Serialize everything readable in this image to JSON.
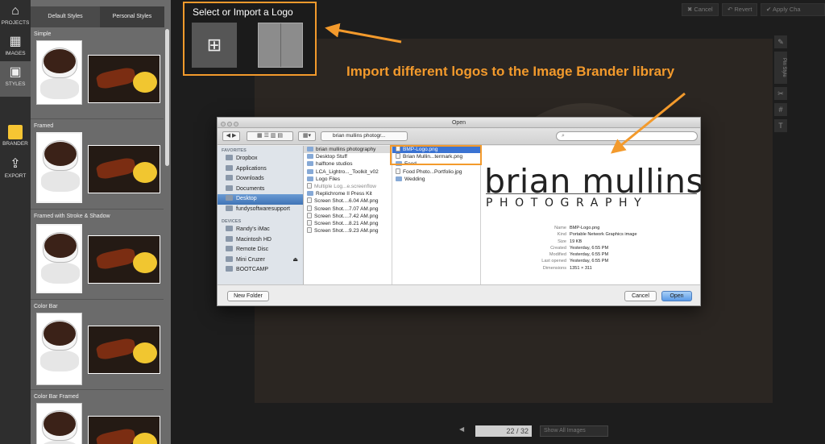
{
  "rail": [
    {
      "label": "PROJECTS",
      "icon": "home-icon",
      "glyph": "⌂"
    },
    {
      "label": "IMAGES",
      "icon": "images-icon",
      "glyph": "▦"
    },
    {
      "label": "STYLES",
      "icon": "styles-icon",
      "glyph": "▣"
    },
    {
      "label": "BRANDER",
      "icon": "brander-icon",
      "glyph": ""
    },
    {
      "label": "EXPORT",
      "icon": "export-icon",
      "glyph": "⇪"
    }
  ],
  "panel": {
    "tabs": [
      "Default Styles",
      "Personal Styles"
    ],
    "groups": [
      "Simple",
      "Framed",
      "Framed with Stroke & Shadow",
      "Color Bar",
      "Color Bar Framed"
    ]
  },
  "top_actions": {
    "cancel": "Cancel",
    "revert": "Revert",
    "apply": "Apply Cha"
  },
  "side_tools": {
    "pin_style": "Pin Style"
  },
  "logo_picker": {
    "title": "Select or Import a Logo",
    "import_glyph": "⊞"
  },
  "callout": "Import different logos to the Image Brander library",
  "dialog": {
    "title": "Open",
    "path": "brian mullins photogr...",
    "search_placeholder": "",
    "favorites_heading": "FAVORITES",
    "favorites": [
      "Dropbox",
      "Applications",
      "Downloads",
      "Documents",
      "Desktop",
      "fundysoftwaresupport"
    ],
    "devices_heading": "DEVICES",
    "devices": [
      "Randy's iMac",
      "Macintosh HD",
      "Remote Disc",
      "Mini Cruzer",
      "BOOTCAMP"
    ],
    "col1": [
      "brian mullins photography",
      "Desktop Stuff",
      "halftone studios",
      "LCA_Lightro..._Toolkit_v02",
      "Logo Files",
      "Multiple Log...e.screenflow",
      "Replichrome II Press Kit",
      "Screen Shot....6.04 AM.png",
      "Screen Shot....7.07 AM.png",
      "Screen Shot....7.42 AM.png",
      "Screen Shot....8.21 AM.png",
      "Screen Shot....9.23 AM.png"
    ],
    "col2": [
      "BMP-Logo.png",
      "Brian Mullin...termark.png",
      "Food",
      "Food Photo...Portfolio.jpg",
      "Wedding"
    ],
    "preview_line1": "brian mullins",
    "preview_line2": "PHOTOGRAPHY",
    "info": [
      {
        "k": "Name",
        "v": "BMP-Logo.png"
      },
      {
        "k": "Kind",
        "v": "Portable Network Graphics image"
      },
      {
        "k": "Size",
        "v": "19 KB"
      },
      {
        "k": "Created",
        "v": "Yesterday, 6:55 PM"
      },
      {
        "k": "Modified",
        "v": "Yesterday, 6:55 PM"
      },
      {
        "k": "Last opened",
        "v": "Yesterday, 6:55 PM"
      },
      {
        "k": "Dimensions",
        "v": "1351 × 311"
      }
    ],
    "new_folder": "New Folder",
    "cancel": "Cancel",
    "open": "Open"
  },
  "pager": {
    "current": "22 / 32",
    "filter": "Show All Images"
  }
}
